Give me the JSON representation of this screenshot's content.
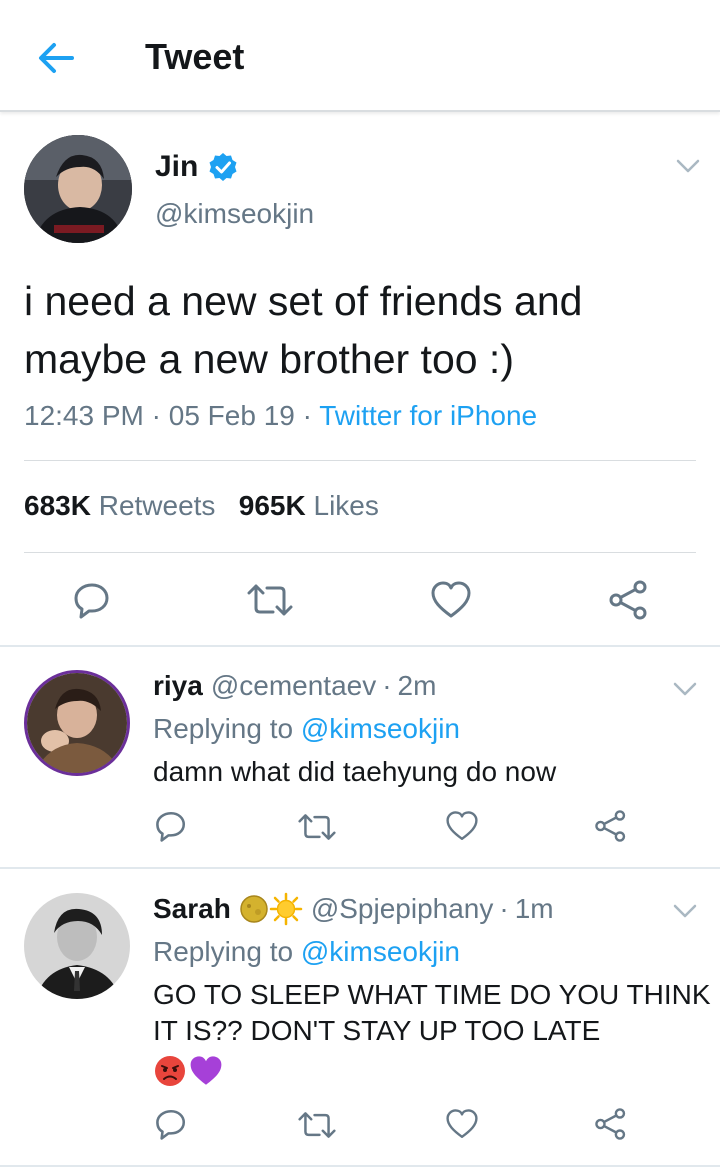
{
  "header": {
    "title": "Tweet",
    "back_icon": "arrow-left-icon"
  },
  "tweet": {
    "author_name": "Jin",
    "author_handle": "@kimseokjin",
    "verified": true,
    "text": "i need a new set of friends and maybe a new brother too :)",
    "time": "12:43 PM",
    "date": "05 Feb 19",
    "separator": "·",
    "client": "Twitter for iPhone",
    "retweets_count": "683K",
    "retweets_label": "Retweets",
    "likes_count": "965K",
    "likes_label": "Likes"
  },
  "replies": [
    {
      "name": "riya",
      "handle": "@cementaev",
      "age": "2m",
      "replying_prefix": "Replying to",
      "replying_to": "@kimseokjin",
      "text": "damn what did taehyung do now"
    },
    {
      "name": "Sarah",
      "name_emojis": [
        "full-moon-face-emoji",
        "sun-emoji"
      ],
      "handle": "@Spjepiphany",
      "age": "1m",
      "replying_prefix": "Replying to",
      "replying_to": "@kimseokjin",
      "text": "GO TO SLEEP WHAT TIME DO YOU THINK IT IS?? DON'T STAY UP TOO LATE",
      "text_emojis": [
        "pouting-face-emoji",
        "purple-heart-emoji"
      ]
    }
  ],
  "colors": {
    "accent": "#1da1f2",
    "secondary_text": "#657786",
    "primary_text": "#14171a",
    "divider": "#e1e8ed"
  }
}
